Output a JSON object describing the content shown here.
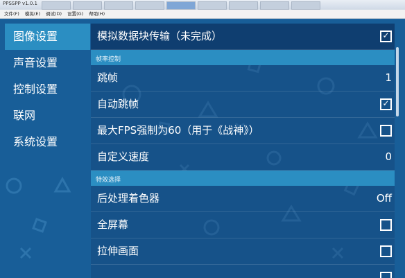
{
  "window": {
    "title": "PPSSPP v1.0.1",
    "tabs": [
      "",
      "",
      "",
      "",
      "",
      "",
      "",
      "",
      ""
    ]
  },
  "menubar": {
    "items": [
      "文件(F)",
      "模拟(E)",
      "调试(D)",
      "设置(G)",
      "帮助(H)"
    ]
  },
  "sidebar": {
    "items": [
      {
        "label": "图像设置"
      },
      {
        "label": "声音设置"
      },
      {
        "label": "控制设置"
      },
      {
        "label": "联网"
      },
      {
        "label": "系统设置"
      }
    ]
  },
  "settings": {
    "block_transfer": {
      "label": "模拟数据块传输（未完成）",
      "checked": true
    },
    "section_frame": "帧率控制",
    "frameskip": {
      "label": "跳帧",
      "value": "1"
    },
    "auto_frameskip": {
      "label": "自动跳帧",
      "checked": true
    },
    "force_60fps": {
      "label": "最大FPS强制为60（用于《战神》）",
      "checked": false
    },
    "custom_speed": {
      "label": "自定义速度",
      "value": "0"
    },
    "section_effects": "特效选择",
    "postprocess": {
      "label": "后处理着色器",
      "value": "Off"
    },
    "fullscreen": {
      "label": "全屏幕",
      "checked": false
    },
    "stretch": {
      "label": "拉伸画面",
      "checked": false
    },
    "partial": {
      "label": "",
      "checked": false
    }
  },
  "colors": {
    "background": "#185e98",
    "sidebar_active": "#2b8ec2",
    "section_header": "#2b8ec2"
  },
  "icons": {
    "checked": "checkbox-checked-icon",
    "unchecked": "checkbox-empty-icon"
  }
}
